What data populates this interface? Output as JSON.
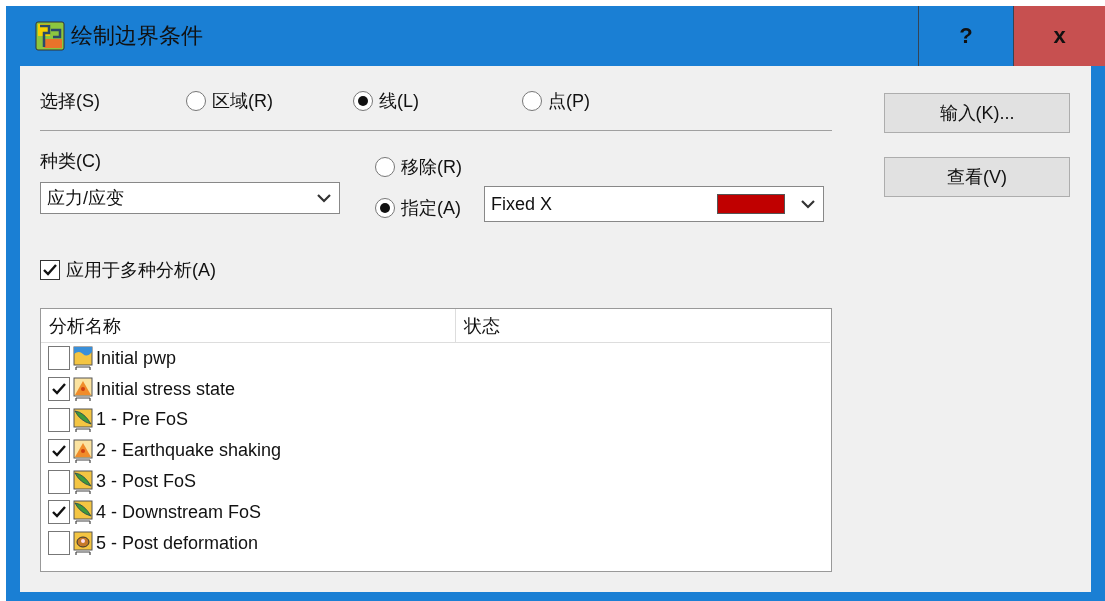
{
  "window": {
    "title": "绘制边界条件",
    "buttons": [
      {
        "kind": "help",
        "label": "?"
      },
      {
        "kind": "close",
        "label": "x"
      }
    ]
  },
  "selection": {
    "label": "选择(S)",
    "options": [
      {
        "label": "区域(R)",
        "selected": false
      },
      {
        "label": "线(L)",
        "selected": true
      },
      {
        "label": "点(P)",
        "selected": false
      }
    ]
  },
  "category": {
    "label": "种类(C)",
    "value": "应力/应变"
  },
  "action": {
    "options": [
      {
        "label": "移除(R)",
        "selected": false
      },
      {
        "label": "指定(A)",
        "selected": true
      }
    ]
  },
  "condition": {
    "value": "Fixed X",
    "color": "#c00000"
  },
  "apply_multiple": {
    "label": "应用于多种分析(A)",
    "checked": true
  },
  "side_buttons": [
    "输入(K)...",
    "查看(V)"
  ],
  "analyses": {
    "columns": [
      "分析名称",
      "状态"
    ],
    "rows": [
      {
        "name": "Initial pwp",
        "kind": "pwp",
        "checked": false
      },
      {
        "name": "Initial stress state",
        "kind": "stress",
        "checked": true
      },
      {
        "name": "1 - Pre FoS",
        "kind": "fos",
        "checked": false
      },
      {
        "name": "2 - Earthquake shaking",
        "kind": "stress",
        "checked": true
      },
      {
        "name": "3 - Post FoS",
        "kind": "fos",
        "checked": false
      },
      {
        "name": "4 - Downstream FoS",
        "kind": "fos",
        "checked": true
      },
      {
        "name": "5 - Post deformation",
        "kind": "deformation",
        "checked": false
      }
    ]
  }
}
